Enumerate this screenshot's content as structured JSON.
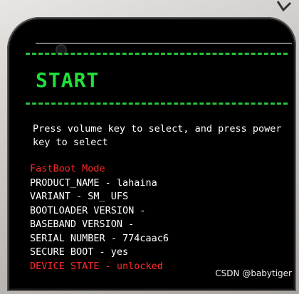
{
  "title": "START",
  "instruction": "Press volume key to select, and press power key to select",
  "fastboot_mode": "FastBoot Mode",
  "info_lines": [
    "PRODUCT_NAME - lahaina",
    "VARIANT - SM_ UFS",
    "BOOTLOADER VERSION -",
    "BASEBAND VERSION -",
    "SERIAL NUMBER - 774caac6",
    "SECURE BOOT - yes"
  ],
  "device_state": "DEVICE STATE - unlocked",
  "watermark": "CSDN @babytiger",
  "colors": {
    "start_green": "#20e03a",
    "dash_green": "#27c23b",
    "warning_red": "#ff2a2a",
    "text_white": "#ffffff",
    "screen_black": "#000000"
  }
}
